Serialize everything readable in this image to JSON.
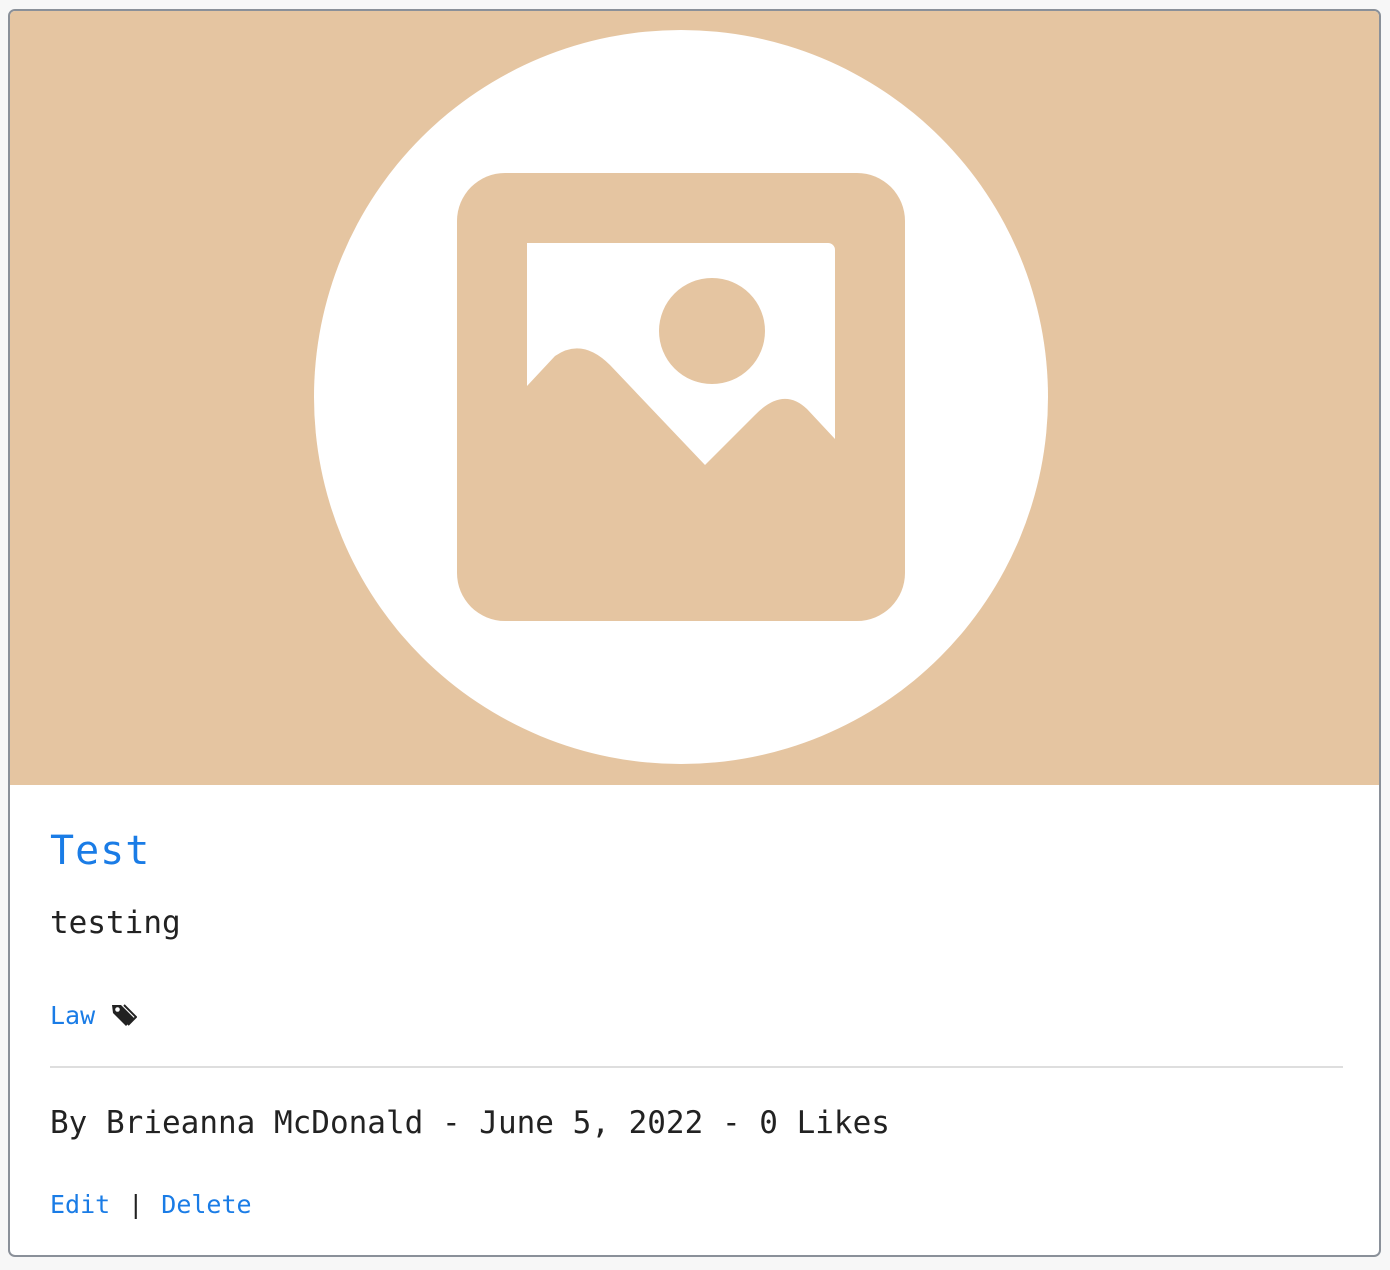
{
  "post": {
    "title": "Test",
    "description": "testing",
    "tag": "Law",
    "tag_icon": "tag-icon",
    "byline": {
      "prefix": "By",
      "author": "Brieanna McDonald",
      "date": "June 5, 2022",
      "likes": "0 Likes",
      "separator": "-"
    },
    "actions": {
      "edit_label": "Edit",
      "separator": "|",
      "delete_label": "Delete"
    },
    "image_icon": "image-placeholder-icon"
  },
  "colors": {
    "hero_background": "#e5c5a1",
    "link": "#1a7ce6",
    "text": "#222222",
    "border": "#8a9099"
  }
}
